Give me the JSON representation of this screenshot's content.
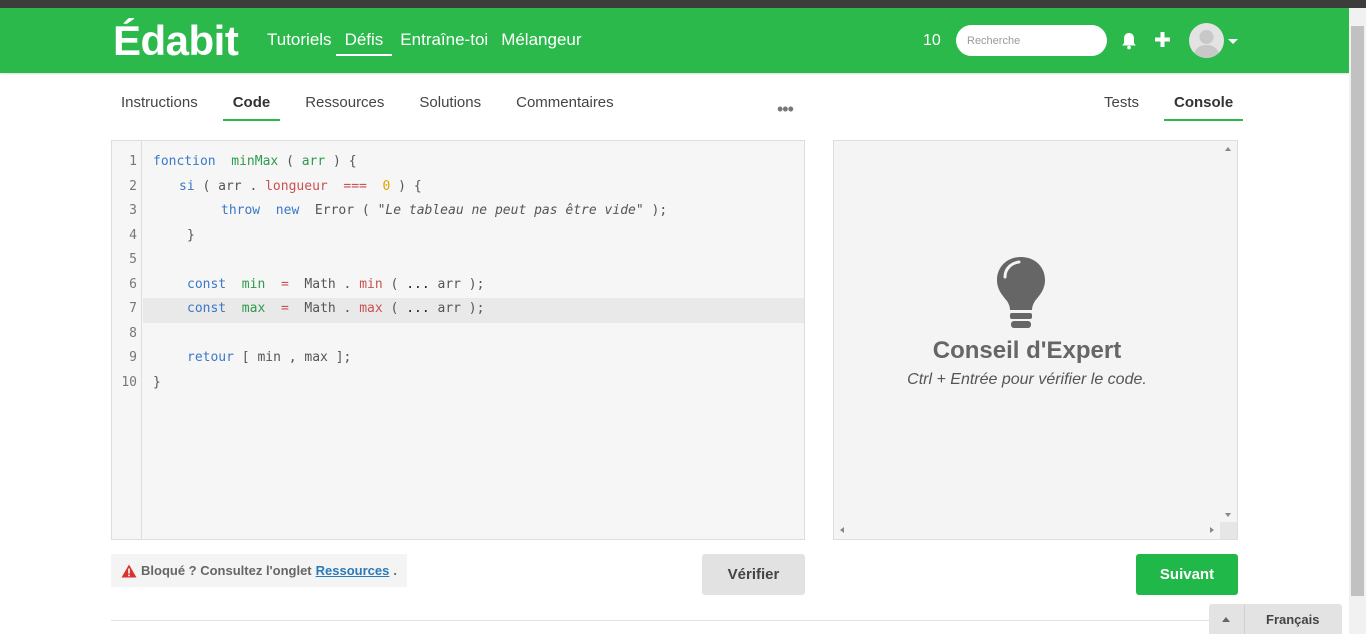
{
  "header": {
    "logo": "Édabit",
    "nav": [
      "Tutoriels",
      "Défis",
      "Entraîne-toi",
      "Mélangeur"
    ],
    "active_nav": "Défis",
    "points": "10",
    "search_placeholder": "Recherche",
    "brand_color": "#2cb94c"
  },
  "tabs": {
    "left": [
      "Instructions",
      "Code",
      "Ressources",
      "Solutions",
      "Commentaires"
    ],
    "active_left": "Code",
    "more": "•••",
    "right": [
      "Tests",
      "Console"
    ],
    "active_right": "Console"
  },
  "editor": {
    "line_numbers": [
      "1",
      "2",
      "3",
      "4",
      "5",
      "6",
      "7",
      "8",
      "9",
      "10"
    ],
    "highlighted_line": 7,
    "lines": [
      "fonction  minMax ( arr ) {",
      "si ( arr . longueur  ===  0 ) {",
      "throw  new  Error ( \"Le tableau ne peut pas être vide\" );",
      "}",
      "",
      "const  min  =  Math . min ( ... arr );",
      "const  max  =  Math . max ( ... arr );",
      "",
      "retour [ min , max ];",
      "}"
    ]
  },
  "console": {
    "tip_title": "Conseil d'Expert",
    "tip_text": "Ctrl + Entrée pour vérifier le code."
  },
  "footer": {
    "blocked_text": "Bloqué ? Consultez l'onglet",
    "blocked_link": "Ressources",
    "blocked_end": ".",
    "verify": "Vérifier",
    "next": "Suivant",
    "language": "Français"
  }
}
